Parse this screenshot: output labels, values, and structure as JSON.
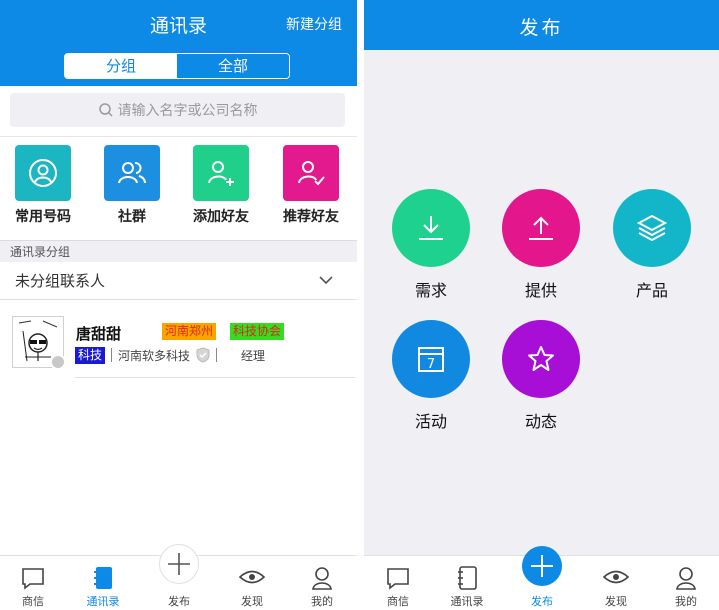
{
  "left": {
    "header": {
      "title": "通讯录",
      "new_group": "新建分组"
    },
    "segment": {
      "groups": "分组",
      "all": "全部"
    },
    "search": {
      "placeholder": "请输入名字或公司名称"
    },
    "quick_actions": [
      {
        "label": "常用号码",
        "icon": "user-circle-icon",
        "color": "#1cb5c2"
      },
      {
        "label": "社群",
        "icon": "group-icon",
        "color": "#1d8fe0"
      },
      {
        "label": "添加好友",
        "icon": "add-user-icon",
        "color": "#1fcf8a"
      },
      {
        "label": "推荐好友",
        "icon": "recommend-user-icon",
        "color": "#e3198e"
      }
    ],
    "section_title": "通讯录分组",
    "group_row": "未分组联系人",
    "contact": {
      "name": "唐甜甜",
      "tag_location": "河南郑州",
      "tag_org": "科技协会",
      "tag_industry": "科技",
      "company": "河南软多科技",
      "role": "经理"
    },
    "tabbar": [
      {
        "label": "商信",
        "icon": "message-icon"
      },
      {
        "label": "通讯录",
        "icon": "contacts-book-icon",
        "active": true
      },
      {
        "label": "发布",
        "icon": "plus-icon"
      },
      {
        "label": "发现",
        "icon": "eye-icon"
      },
      {
        "label": "我的",
        "icon": "person-icon"
      }
    ]
  },
  "right": {
    "header": {
      "title": "发布"
    },
    "publish_items": [
      {
        "label": "需求",
        "icon": "download-icon",
        "color": "#1fd18e"
      },
      {
        "label": "提供",
        "icon": "upload-icon",
        "color": "#e3168c"
      },
      {
        "label": "产品",
        "icon": "layers-icon",
        "color": "#13b6c9"
      },
      {
        "label": "活动",
        "icon": "calendar-icon",
        "color": "#1289e0"
      },
      {
        "label": "动态",
        "icon": "star-icon",
        "color": "#a70fd6"
      }
    ],
    "calendar_day": "7",
    "tabbar": [
      {
        "label": "商信",
        "icon": "message-icon"
      },
      {
        "label": "通讯录",
        "icon": "contacts-book-icon"
      },
      {
        "label": "发布",
        "icon": "plus-icon",
        "active": true
      },
      {
        "label": "发现",
        "icon": "eye-icon"
      },
      {
        "label": "我的",
        "icon": "person-icon"
      }
    ]
  },
  "colors": {
    "brand_blue": "#0d89e6",
    "page_gray": "#efeff4"
  }
}
